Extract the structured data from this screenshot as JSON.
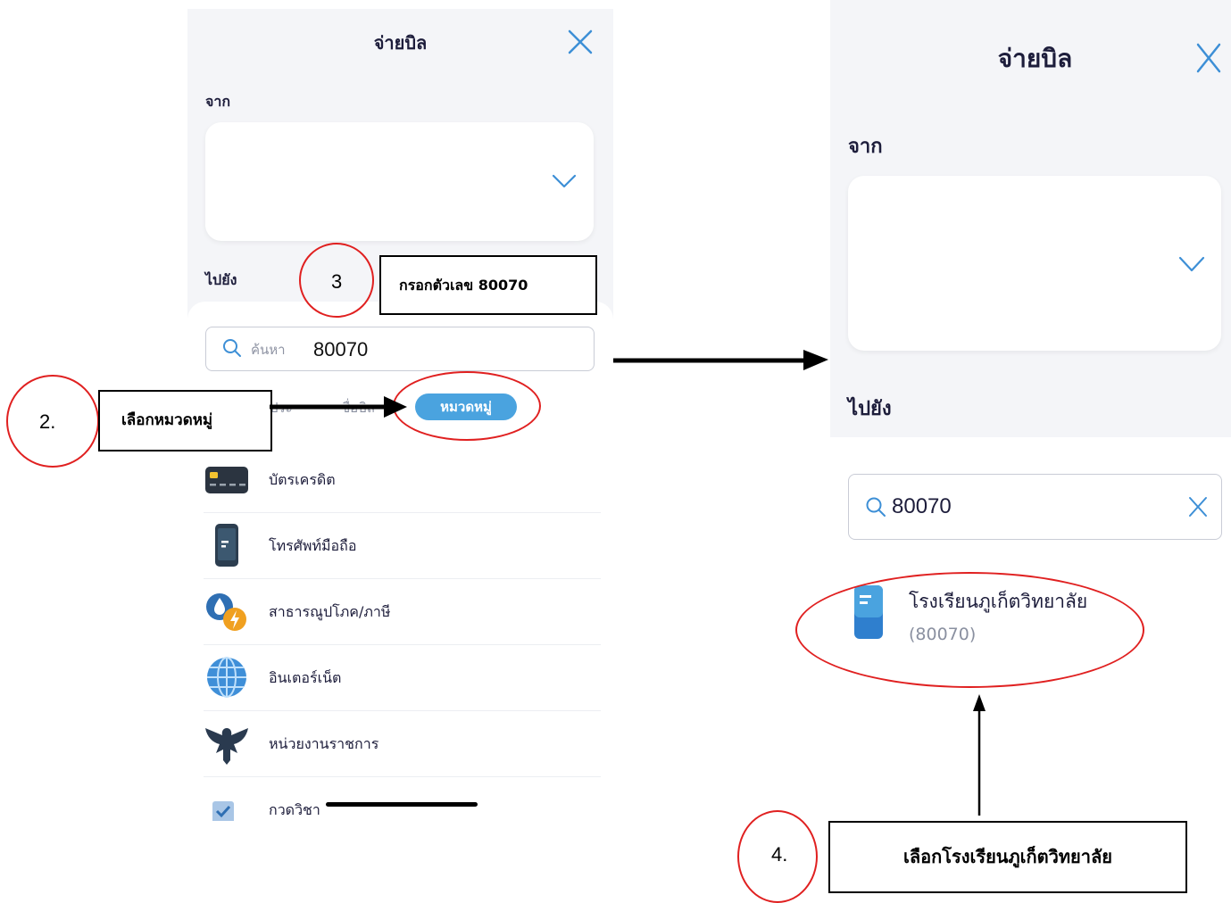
{
  "left_screen": {
    "title": "จ่ายบิล",
    "from_label": "จาก",
    "to_label": "ไปยัง",
    "search": {
      "placeholder": "ค้นหา",
      "value": "80070"
    },
    "tabs": {
      "first_partial": "ประ",
      "second_partial": "ชื่อบิล",
      "active": "หมวดหมู่"
    },
    "categories": [
      {
        "label": "บัตรเครดิต",
        "icon": "credit-card-icon"
      },
      {
        "label": "โทรศัพท์มือถือ",
        "icon": "mobile-phone-icon"
      },
      {
        "label": "สาธารณูปโภค/ภาษี",
        "icon": "utilities-icon"
      },
      {
        "label": "อินเตอร์เน็ต",
        "icon": "globe-icon"
      },
      {
        "label": "หน่วยงานราชการ",
        "icon": "garuda-icon"
      },
      {
        "label": "กวดวิชา",
        "icon": "checklist-icon"
      }
    ]
  },
  "right_screen": {
    "title": "จ่ายบิล",
    "from_label": "จาก",
    "to_label": "ไปยัง",
    "search_value": "80070",
    "result": {
      "name": "โรงเรียนภูเก็ตวิทยาลัย",
      "code": "(80070)"
    }
  },
  "annotations": {
    "step2_number": "2.",
    "step2_text": "เลือกหมวดหมู่",
    "step3_number": "3",
    "step3_text": "กรอกตัวเลข 80070",
    "step4_number": "4.",
    "step4_text": "เลือกโรงเรียนภูเก็ตวิทยาลัย"
  },
  "colors": {
    "accent": "#4aa3df",
    "annotation_red": "#e02020",
    "bg_gray": "#f4f5f8"
  }
}
